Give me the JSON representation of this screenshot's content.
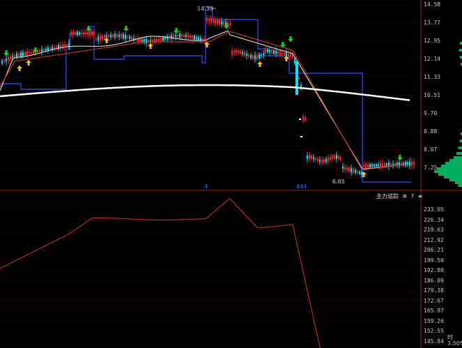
{
  "main_chart": {
    "price_axis_labels": [
      "14.58",
      "13.77",
      "12.95",
      "12.14",
      "11.33",
      "10.51",
      "9.70",
      "8.88",
      "8.07",
      "7.25"
    ],
    "high_annotation": "14.39",
    "low_annotation": "6.65",
    "markers": [
      "4",
      "444"
    ]
  },
  "indicator": {
    "title": "主力追踪",
    "gear_symbol": "✲",
    "help_symbol": "?",
    "close_symbol": "≡",
    "axis_labels": [
      "233.05",
      "226.34",
      "219.63",
      "212.92",
      "206.21",
      "199.50",
      "192.80",
      "186.09",
      "179.38",
      "172.67",
      "165.97",
      "159.26",
      "152.55",
      "145.84"
    ]
  },
  "corner": {
    "line1": "时",
    "line2": "3.50%"
  },
  "colors": {
    "background": "#000000",
    "up_candle": "#ff2020",
    "down_candle": "#00e5ff",
    "ma_long": "#ffffff",
    "ma_mid": "#c0392b",
    "ma_short": "#f5f5dc",
    "step_line": "#3050ff",
    "arrow_up": "#ffc000",
    "arrow_down": "#20d020",
    "indicator_line": "#b03020",
    "volume_profile": "#00b060"
  }
}
